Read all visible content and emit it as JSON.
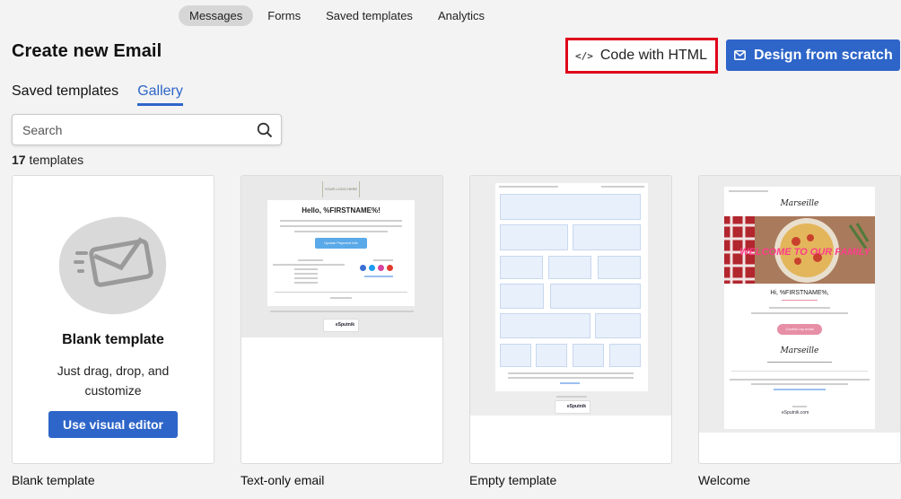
{
  "topnav": {
    "tabs": [
      "Messages",
      "Forms",
      "Saved templates",
      "Analytics"
    ]
  },
  "header": {
    "title": "Create new Email",
    "code_html_label": "Code with HTML",
    "design_label": "Design from scratch"
  },
  "subtabs": [
    "Saved templates",
    "Gallery"
  ],
  "search": {
    "placeholder": "Search"
  },
  "count": {
    "number": "17",
    "label": " templates"
  },
  "blank_card": {
    "title": "Blank template",
    "description": "Just drag, drop, and customize",
    "button": "Use visual editor"
  },
  "cards": [
    {
      "label": "Blank template"
    },
    {
      "label": "Text-only email"
    },
    {
      "label": "Empty template"
    },
    {
      "label": "Welcome"
    }
  ],
  "previews": {
    "text_only": {
      "logo": "YOUR LOGO HERE",
      "greeting": "Hello, %FIRSTNAME%!",
      "button": "Update Payment Info",
      "brand": "eSputnik"
    },
    "welcome": {
      "brand_name": "Marseille",
      "hero_text": "WELCOME TO OUR FAMILY",
      "greeting": "Hi, %FIRSTNAME%,",
      "button": "Confirm my email",
      "footer_brand": "eSputnik.com"
    }
  },
  "colors": {
    "accent": "#2e65c9",
    "highlight_border": "#e0001b",
    "active_tab_bg": "#d6d6d6"
  }
}
